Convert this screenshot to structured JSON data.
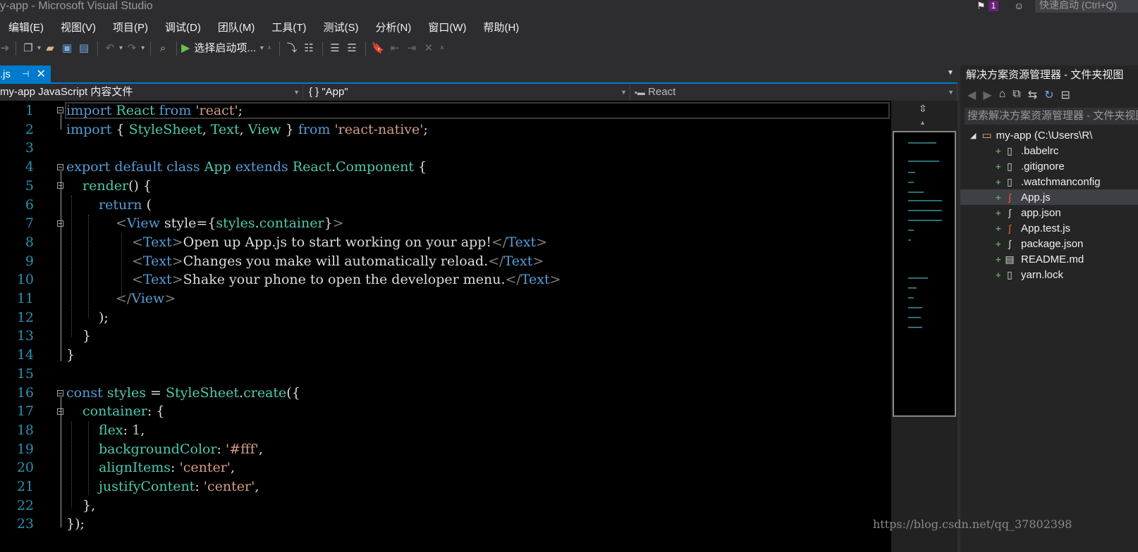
{
  "window": {
    "title": "y-app - Microsoft Visual Studio",
    "notification_count": "1",
    "quick_launch_placeholder": "快速启动 (Ctrl+Q)"
  },
  "menu": [
    "编辑(E)",
    "视图(V)",
    "项目(P)",
    "调试(D)",
    "团队(M)",
    "工具(T)",
    "测试(S)",
    "分析(N)",
    "窗口(W)",
    "帮助(H)"
  ],
  "toolbar": {
    "start_label": "选择启动项..."
  },
  "tab": {
    "name": ".js"
  },
  "navbar": {
    "project": "my-app JavaScript 内容文件",
    "scope": "{ } \"App\"",
    "member": "React"
  },
  "code_lines": [
    "1",
    "2",
    "3",
    "4",
    "5",
    "6",
    "7",
    "8",
    "9",
    "10",
    "11",
    "12",
    "13",
    "14",
    "15",
    "16",
    "17",
    "18",
    "19",
    "20",
    "21",
    "22",
    "23"
  ],
  "code": {
    "l1": [
      "import",
      " React ",
      "from",
      " ",
      "'react'",
      ";"
    ],
    "l2": [
      "import",
      " { ",
      "StyleSheet",
      ", ",
      "Text",
      ", ",
      "View",
      " } ",
      "from",
      " ",
      "'react-native'",
      ";"
    ],
    "l4": [
      "export default class",
      " ",
      "App",
      " ",
      "extends",
      " ",
      "React",
      ".",
      "Component",
      " {"
    ],
    "l5": [
      "render",
      "() {"
    ],
    "l6": [
      "return",
      " ("
    ],
    "l7": [
      "<",
      "View",
      " style",
      "=",
      "{",
      "styles",
      ".",
      "container",
      "}",
      ">"
    ],
    "l8": [
      "<",
      "Text",
      ">",
      "Open up App.js to start working on your app!",
      "</",
      "Text",
      ">"
    ],
    "l9": [
      "<",
      "Text",
      ">",
      "Changes you make will automatically reload.",
      "</",
      "Text",
      ">"
    ],
    "l10": [
      "<",
      "Text",
      ">",
      "Shake your phone to open the developer menu.",
      "</",
      "Text",
      ">"
    ],
    "l11": [
      "</",
      "View",
      ">"
    ],
    "l12": [
      ");"
    ],
    "l13": [
      "}"
    ],
    "l14": [
      "}"
    ],
    "l16": [
      "const",
      " ",
      "styles",
      " = ",
      "StyleSheet",
      ".",
      "create",
      "({"
    ],
    "l17": [
      "container",
      ": {"
    ],
    "l18": [
      "flex",
      ": ",
      "1",
      ","
    ],
    "l19": [
      "backgroundColor",
      ": ",
      "'#fff'",
      ","
    ],
    "l20": [
      "alignItems",
      ": ",
      "'center'",
      ","
    ],
    "l21": [
      "justifyContent",
      ": ",
      "'center'",
      ","
    ],
    "l22": [
      "},"
    ],
    "l23": [
      "});"
    ]
  },
  "solution_explorer": {
    "title": "解决方案资源管理器 - 文件夹视图",
    "search_placeholder": "搜索解决方案资源管理器 - 文件夹视图",
    "root": "my-app (C:\\Users\\R\\",
    "items": [
      ".babelrc",
      ".gitignore",
      ".watchmanconfig",
      "App.js",
      "app.json",
      "App.test.js",
      "package.json",
      "README.md",
      "yarn.lock"
    ],
    "selected": "App.js"
  },
  "watermark": "https://blog.csdn.net/qq_37802398",
  "colors": {
    "accent": "#007acc",
    "keyword": "#569cd6",
    "type": "#4ec9b0",
    "string": "#d69d85",
    "line_number": "#2b91af",
    "editor_bg": "#000000"
  }
}
